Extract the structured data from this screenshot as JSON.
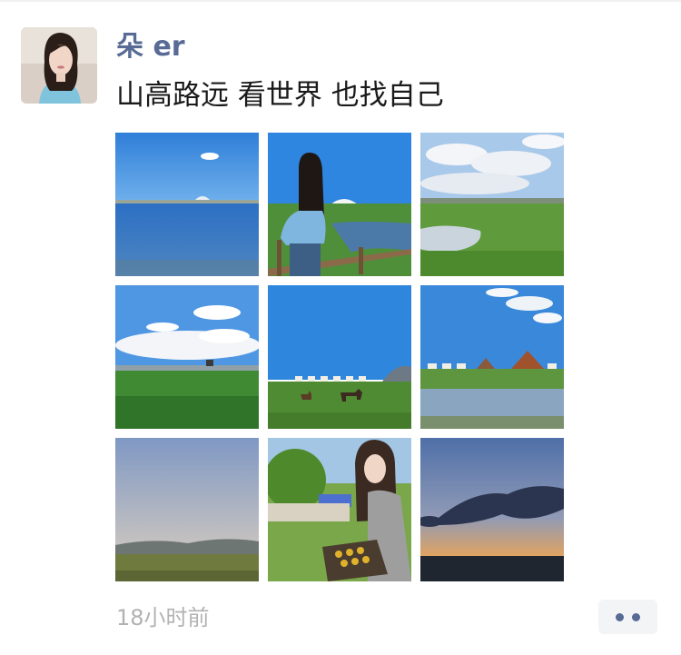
{
  "post": {
    "author": "朵 er",
    "text": "山高路远 看世界 也找自己",
    "timestamp": "18小时前"
  },
  "photos": [
    {
      "subject": "lake-with-domed-building"
    },
    {
      "subject": "girl-on-boardwalk-by-river"
    },
    {
      "subject": "grassland-with-pond"
    },
    {
      "subject": "green-field-with-clouds"
    },
    {
      "subject": "horses-on-grassland"
    },
    {
      "subject": "yurt-camp-by-water"
    },
    {
      "subject": "evening-hills"
    },
    {
      "subject": "girl-at-barbecue"
    },
    {
      "subject": "sunset-sky"
    }
  ],
  "icons": {
    "more": "more-dots-icon"
  },
  "colors": {
    "name": "#576b95",
    "timestamp": "#b2b2b2",
    "more_bg": "#f3f4f6"
  }
}
